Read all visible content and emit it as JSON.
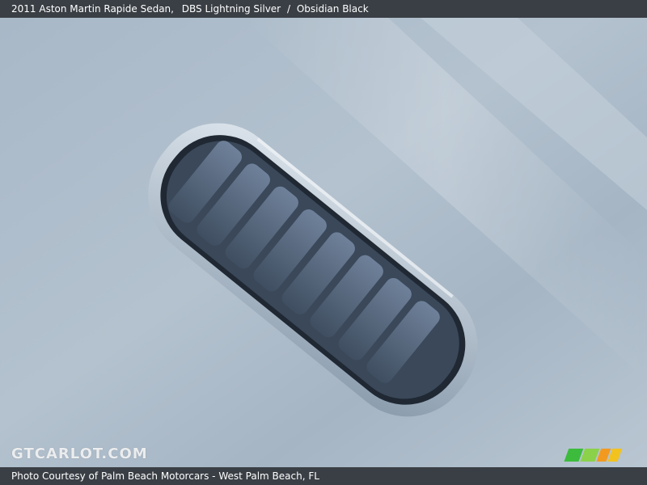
{
  "header": {
    "title": "2011 Aston Martin Rapide Sedan,",
    "color": "DBS Lightning Silver",
    "separator": "/",
    "interior": "Obsidian Black"
  },
  "footer": {
    "credit": "Photo Courtesy of Palm Beach Motorcars - West Palm Beach, FL"
  },
  "watermark": {
    "text": "GTCARLOT.COM"
  },
  "photo": {
    "subject": "louvered hood vent on silver car body",
    "colors": {
      "body": "#a9b8c6",
      "highlight": "#d4dde6",
      "vent_dark": "#2a3340",
      "louver": "#53647a"
    }
  },
  "icons": {
    "logo_stripes": [
      "#3dbb3d",
      "#8bd14a",
      "#f29a1f",
      "#f2c21f"
    ]
  }
}
